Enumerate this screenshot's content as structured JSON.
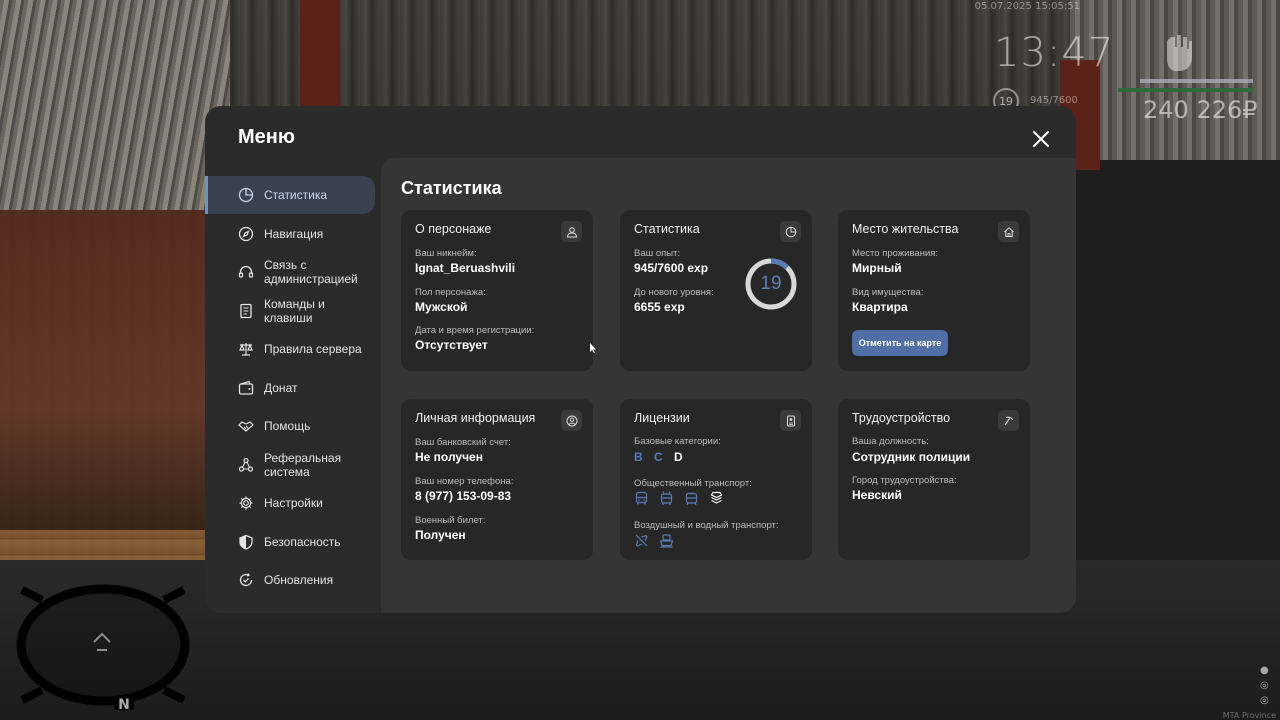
{
  "hud": {
    "datetime": "05.07.2025 15:05:51",
    "time": "13:47",
    "level": "19",
    "exp": "945/7600",
    "money": "240 226₽",
    "server_label": "MTA Province"
  },
  "menu": {
    "title": "Меню",
    "sidebar": [
      {
        "label": "Статистика",
        "icon": "pie-chart-icon",
        "active": true
      },
      {
        "label": "Навигация",
        "icon": "compass-icon"
      },
      {
        "label": "Связь с администрацией",
        "icon": "headset-icon"
      },
      {
        "label": "Команды и клавиши",
        "icon": "document-icon"
      },
      {
        "label": "Правила сервера",
        "icon": "scales-icon"
      },
      {
        "label": "Донат",
        "icon": "wallet-icon"
      },
      {
        "label": "Помощь",
        "icon": "handshake-icon"
      },
      {
        "label": "Реферальная система",
        "icon": "network-icon"
      },
      {
        "label": "Настройки",
        "icon": "gear-icon"
      },
      {
        "label": "Безопасность",
        "icon": "shield-icon"
      },
      {
        "label": "Обновления",
        "icon": "refresh-check-icon"
      }
    ]
  },
  "content": {
    "title": "Статистика",
    "character": {
      "title": "О персонаже",
      "nickname_label": "Ваш никнейм:",
      "nickname": "Ignat_Beruashvili",
      "gender_label": "Пол персонажа:",
      "gender": "Мужской",
      "reg_label": "Дата и время регистрации:",
      "reg": "Отсутствует"
    },
    "stats": {
      "title": "Статистика",
      "exp_label": "Ваш опыт:",
      "exp": "945/7600 exp",
      "next_label": "До нового уровня:",
      "next": "6655 exp",
      "level": "19",
      "progress": 0.124
    },
    "residence": {
      "title": "Место жительства",
      "place_label": "Место проживания:",
      "place": "Мирный",
      "property_label": "Вид имущества:",
      "property": "Квартира",
      "map_button": "Отметить на карте"
    },
    "personal": {
      "title": "Личная информация",
      "bank_label": "Ваш банковский счет:",
      "bank": "Не получен",
      "phone_label": "Ваш номер телефона:",
      "phone": "8 (977) 153-09-83",
      "military_label": "Военный билет:",
      "military": "Получен"
    },
    "licenses": {
      "title": "Лицензии",
      "basic_label": "Базовые категории:",
      "categories": [
        {
          "letter": "B",
          "owned": true
        },
        {
          "letter": "C",
          "owned": true
        },
        {
          "letter": "D",
          "owned": false
        }
      ],
      "public_label": "Общественный транспорт:",
      "air_label": "Воздушный и водный транспорт:"
    },
    "employment": {
      "title": "Трудоустройство",
      "position_label": "Ваша должность:",
      "position": "Сотрудник полиции",
      "city_label": "Город трудоустройства:",
      "city": "Невский"
    }
  },
  "colors": {
    "accent": "#5a7cb6",
    "button": "#4f6fa5",
    "panel": "#2b2b2b",
    "content": "#353535",
    "card": "#272727"
  }
}
